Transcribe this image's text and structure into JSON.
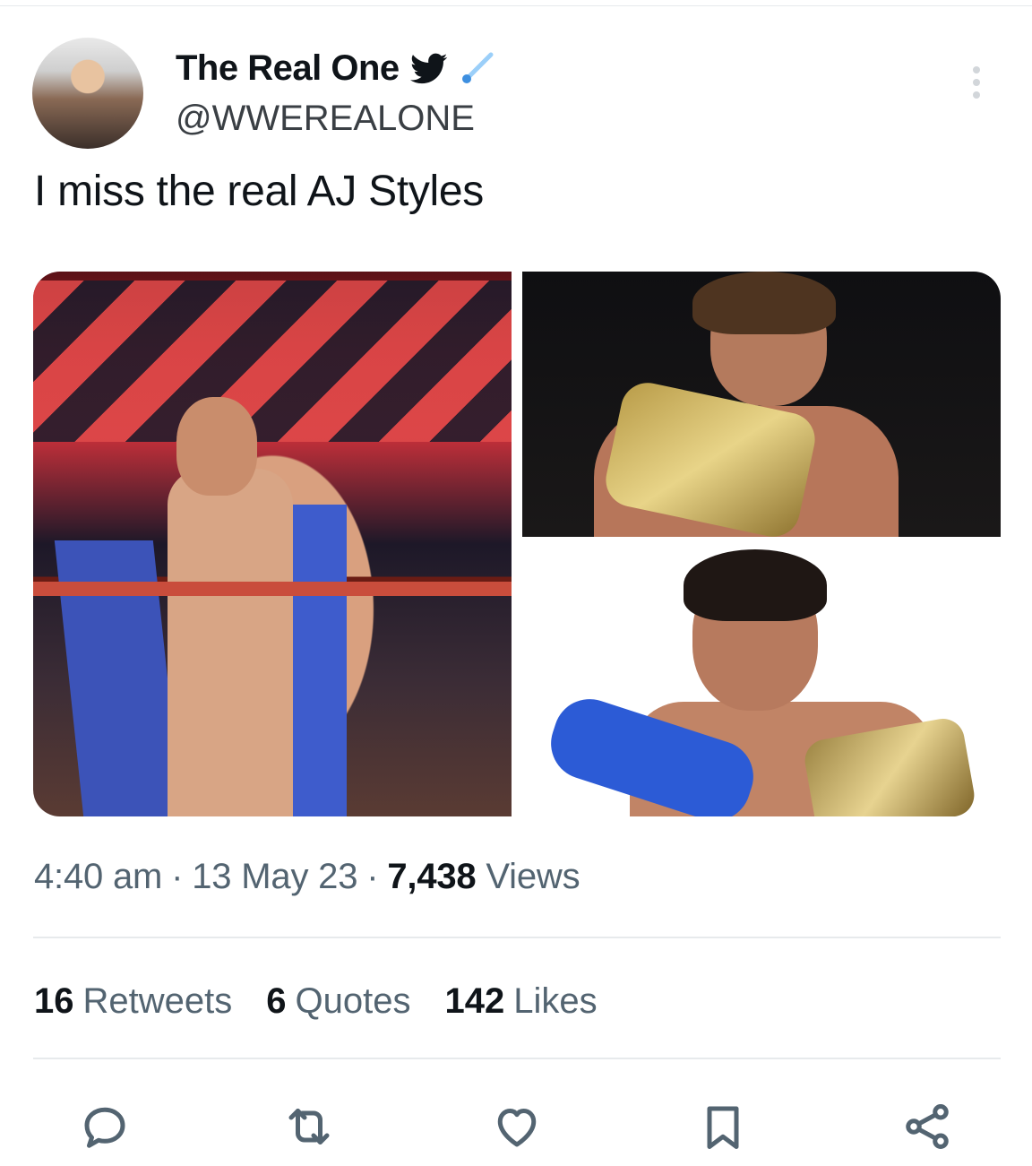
{
  "header": {
    "display_name": "The Real One",
    "username": "@WWEREALONE",
    "more_icon": "more-vertical-icon"
  },
  "tweet": {
    "text": "I miss the real AJ Styles"
  },
  "meta": {
    "time": "4:40 am",
    "separator": "·",
    "date": "13 May 23",
    "views_count": "7,438",
    "views_label": "Views"
  },
  "stats": {
    "retweets_count": "16",
    "retweets_label": "Retweets",
    "quotes_count": "6",
    "quotes_label": "Quotes",
    "likes_count": "142",
    "likes_label": "Likes"
  },
  "actions": [
    "reply-icon",
    "retweet-icon",
    "like-icon",
    "bookmark-icon",
    "share-icon"
  ],
  "colors": {
    "text_primary": "#0f1419",
    "text_secondary": "#536471",
    "divider": "#e7eaec",
    "twitter_blue": "#1d9bf0"
  }
}
